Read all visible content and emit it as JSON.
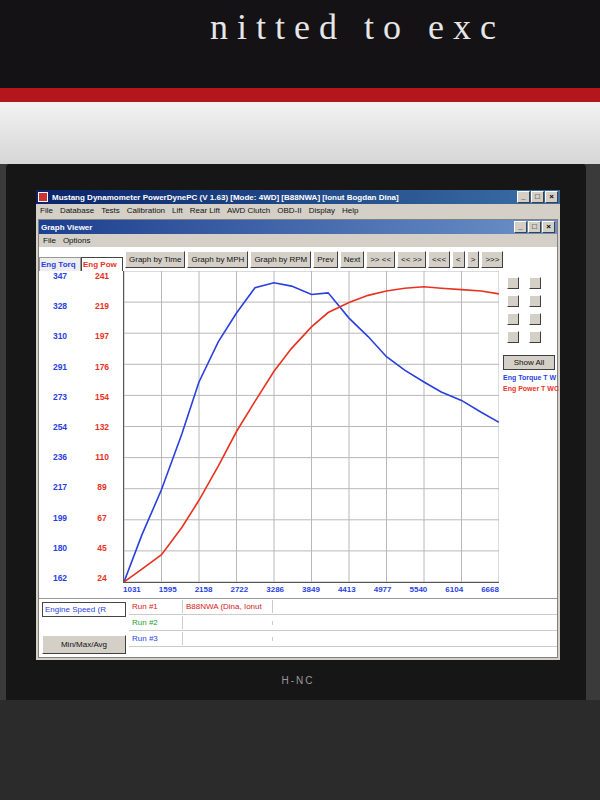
{
  "backdrop": {
    "sign_text": "nitted to exc"
  },
  "monitor": {
    "brand": "H-NC"
  },
  "app": {
    "title": "Mustang Dynamometer PowerDynePC (V 1.63) [Mode: 4WD] [B88NWA] [Ionut Bogdan Dina]",
    "menu": [
      "File",
      "Database",
      "Tests",
      "Calibration",
      "Lift",
      "Rear Lift",
      "AWD Clutch",
      "OBD-II",
      "Display",
      "Help"
    ],
    "controls": [
      "_",
      "□",
      "×"
    ]
  },
  "graph_viewer": {
    "title": "Graph Viewer",
    "controls": [
      "_",
      "□",
      "×"
    ],
    "menu": [
      "File",
      "Options"
    ],
    "axis_tabs": [
      {
        "label": "Eng Torq",
        "selected": false,
        "color": "#2a3fe0"
      },
      {
        "label": "Eng Pow",
        "selected": true,
        "color": "#e8321f"
      }
    ],
    "toolbar": [
      "Graph by Time",
      "Graph by MPH",
      "Graph by RPM",
      "Prev",
      "Next",
      ">> <<",
      "<< >>",
      "<<<",
      "<",
      ">",
      ">>>"
    ],
    "y_ticks_torque": [
      "347",
      "328",
      "310",
      "291",
      "273",
      "254",
      "236",
      "217",
      "199",
      "180",
      "162"
    ],
    "y_ticks_power": [
      "241",
      "219",
      "197",
      "176",
      "154",
      "132",
      "110",
      "89",
      "67",
      "45",
      "24"
    ],
    "x_ticks": [
      "1031",
      "1595",
      "2158",
      "2722",
      "3286",
      "3849",
      "4413",
      "4977",
      "5540",
      "6104",
      "6668"
    ],
    "series": [
      {
        "name": "Eng Torque T W",
        "axis": "torque",
        "color": "#2a3fe0",
        "rpm": [
          1031,
          1300,
          1595,
          1900,
          2158,
          2450,
          2722,
          3000,
          3286,
          3550,
          3849,
          4100,
          4413,
          4700,
          4977,
          5250,
          5540,
          5800,
          6104,
          6400,
          6668
        ],
        "values": [
          162,
          190,
          217,
          250,
          281,
          305,
          322,
          337,
          340,
          338,
          333,
          334,
          319,
          308,
          296,
          288,
          281,
          275,
          270,
          263,
          257
        ]
      },
      {
        "name": "Eng Power T WC",
        "axis": "power",
        "color": "#e8321f",
        "rpm": [
          1031,
          1300,
          1595,
          1900,
          2158,
          2450,
          2722,
          3000,
          3286,
          3550,
          3849,
          4100,
          4413,
          4700,
          4977,
          5250,
          5540,
          5800,
          6104,
          6400,
          6668
        ],
        "values": [
          24,
          33,
          43,
          62,
          81,
          105,
          129,
          150,
          171,
          187,
          202,
          212,
          219,
          224,
          227,
          229,
          230,
          229,
          228,
          227,
          225
        ]
      }
    ],
    "side_button": "Show All",
    "x_axis_select": "Engine Speed (R",
    "stats_button": "Min/Max/Avg",
    "runs": [
      {
        "label": "Run #1",
        "color": "#d42020",
        "vehicle": "B88NWA (Dina, Ionut"
      },
      {
        "label": "Run #2",
        "color": "#1f9e2c",
        "vehicle": ""
      },
      {
        "label": "Run #3",
        "color": "#2a3fe0",
        "vehicle": ""
      }
    ]
  }
}
